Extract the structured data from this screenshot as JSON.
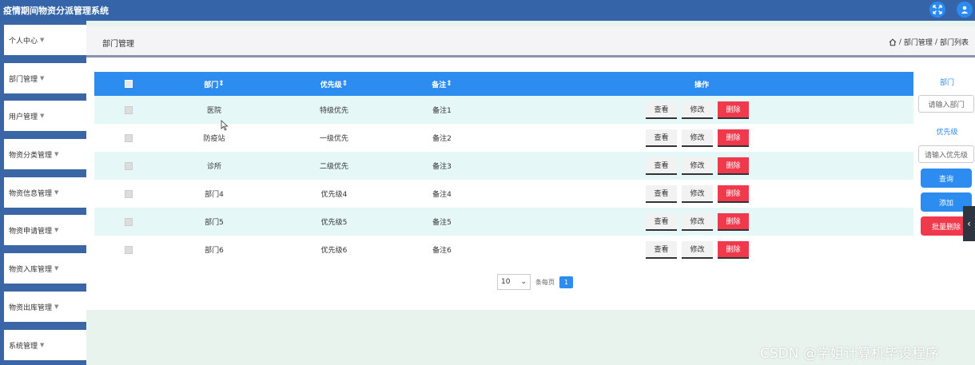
{
  "app": {
    "title": "疫情期间物资分派管理系统"
  },
  "topbar": {
    "fullscreen_icon": "fullscreen-icon",
    "user_icon": "user-icon"
  },
  "sidebar": {
    "items": [
      {
        "label": "个人中心"
      },
      {
        "label": "部门管理"
      },
      {
        "label": "用户管理"
      },
      {
        "label": "物资分类管理"
      },
      {
        "label": "物资信息管理"
      },
      {
        "label": "物资申请管理"
      },
      {
        "label": "物资入库管理"
      },
      {
        "label": "物资出库管理"
      },
      {
        "label": "系统管理"
      }
    ]
  },
  "header": {
    "title": "部门管理",
    "breadcrumb": {
      "part1": "部门管理",
      "separator": "/",
      "part2": "部门列表"
    }
  },
  "table": {
    "columns": {
      "dept": "部门",
      "priority": "优先级",
      "note": "备注",
      "ops": "操作"
    },
    "sort_glyph": "⇕",
    "actions": {
      "view": "查看",
      "edit": "修改",
      "delete": "删除"
    },
    "rows": [
      {
        "dept": "医院",
        "priority": "特级优先",
        "note": "备注1"
      },
      {
        "dept": "防疫站",
        "priority": "一级优先",
        "note": "备注2"
      },
      {
        "dept": "诊所",
        "priority": "二级优先",
        "note": "备注3"
      },
      {
        "dept": "部门4",
        "priority": "优先级4",
        "note": "备注4"
      },
      {
        "dept": "部门5",
        "priority": "优先级5",
        "note": "备注5"
      },
      {
        "dept": "部门6",
        "priority": "优先级6",
        "note": "备注6"
      }
    ]
  },
  "pagination": {
    "page_size": "10",
    "page_size_label": "条每页",
    "current_page": "1"
  },
  "search_panel": {
    "dept_label": "部门",
    "dept_placeholder": "请输入部门",
    "priority_label": "优先级",
    "priority_placeholder": "请输入优先级",
    "query_button": "查询",
    "add_button": "添加",
    "batch_delete_button": "批量删除"
  },
  "watermark": "CSDN @学姐计算机毕设程序",
  "colors": {
    "accent": "#2d8cf0",
    "danger": "#f0394d",
    "topbar": "#3565a8",
    "row_alt": "#e6f7f7"
  }
}
